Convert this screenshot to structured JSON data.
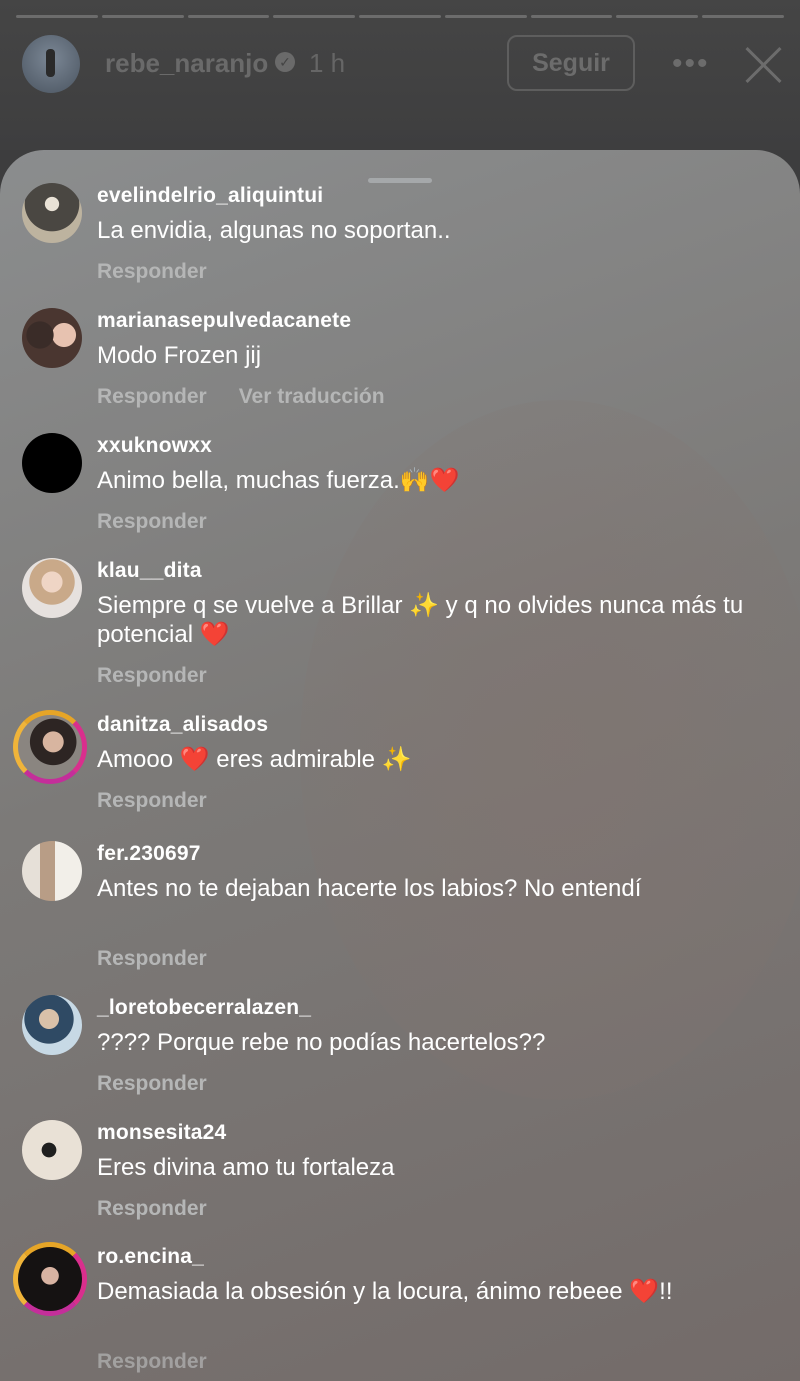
{
  "story": {
    "username": "rebe_naranjo",
    "time": "1 h",
    "follow_label": "Seguir",
    "more_icon": "more-horizontal-icon",
    "close_icon": "close-icon"
  },
  "comments": [
    {
      "username": "evelindelrio_aliquintui",
      "text": "La envidia, algunas no soportan..",
      "reply": "Responder"
    },
    {
      "username": "marianasepulvedacanete",
      "text": "Modo Frozen jij",
      "reply": "Responder",
      "translate": "Ver traducción"
    },
    {
      "username": "xxuknowxx",
      "text": "Animo bella, muchas fuerza.🙌❤️",
      "reply": "Responder"
    },
    {
      "username": "klau__dita",
      "text": "Siempre q se vuelve a Brillar ✨ y q no olvides nunca más tu potencial ❤️",
      "reply": "Responder"
    },
    {
      "username": "danitza_alisados",
      "text": "Amooo ❤️ eres admirable ✨",
      "reply": "Responder"
    },
    {
      "username": "fer.230697",
      "text": "Antes no te dejaban hacerte los labios? No entendí",
      "reply": "Responder"
    },
    {
      "username": "_loretobecerralazen_",
      "text": "???? Porque rebe no podías hacertelos??",
      "reply": "Responder"
    },
    {
      "username": "monsesita24",
      "text": "Eres divina amo tu fortaleza",
      "reply": "Responder"
    },
    {
      "username": "ro.encina_",
      "text": "Demasiada la obsesión y la locura, ánimo rebeee ❤️!!",
      "reply": "Responder"
    }
  ]
}
